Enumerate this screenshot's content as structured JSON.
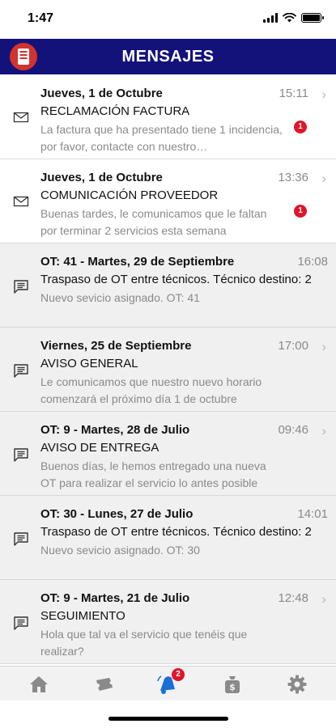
{
  "status_bar": {
    "time": "1:47"
  },
  "header": {
    "title": "MENSAJES",
    "logo_icon": "app-logo-icon"
  },
  "messages": [
    {
      "type": "email",
      "date": "Jueves, 1 de Octubre",
      "time": "15:11",
      "subject": "RECLAMACIÓN FACTURA",
      "preview": "La factura que ha presentado tiene 1 incidencia, por favor, contacte con nuestro…",
      "badge": "1",
      "read": false,
      "chevron": true
    },
    {
      "type": "email",
      "date": "Jueves, 1 de Octubre",
      "time": "13:36",
      "subject": "COMUNICACIÓN PROVEEDOR",
      "preview": "Buenas tardes, le comunicamos que le faltan por terminar 2 servicios esta semana",
      "badge": "1",
      "read": false,
      "chevron": true
    },
    {
      "type": "chat",
      "date": "OT: 41 - Martes, 29 de Septiembre",
      "time": "16:08",
      "subject": "Traspaso de OT entre técnicos. Técnico destino: 2",
      "preview": "Nuevo sevicio asignado. OT: 41",
      "badge": "",
      "read": true,
      "chevron": false
    },
    {
      "type": "chat",
      "date": "Viernes, 25 de Septiembre",
      "time": "17:00",
      "subject": "AVISO GENERAL",
      "preview": "Le comunicamos que nuestro nuevo horario comenzará el próximo día 1 de octubre",
      "badge": "",
      "read": true,
      "chevron": true
    },
    {
      "type": "chat",
      "date": "OT: 9 - Martes, 28 de Julio",
      "time": "09:46",
      "subject": "AVISO DE ENTREGA",
      "preview": "Buenos días, le hemos entregado una nueva OT para realizar el servicio lo antes posible",
      "badge": "",
      "read": true,
      "chevron": true
    },
    {
      "type": "chat",
      "date": "OT: 30 - Lunes, 27 de Julio",
      "time": "14:01",
      "subject": "Traspaso de OT entre técnicos. Técnico destino: 2",
      "preview": "Nuevo sevicio asignado. OT: 30",
      "badge": "",
      "read": true,
      "chevron": false
    },
    {
      "type": "chat",
      "date": "OT: 9 - Martes, 21 de Julio",
      "time": "12:48",
      "subject": "SEGUIMIENTO",
      "preview": "Hola que tal va el servicio que tenéis que realizar?",
      "badge": "",
      "read": true,
      "chevron": true
    }
  ],
  "tabbar": {
    "tabs": [
      {
        "icon": "home-icon",
        "active": false
      },
      {
        "icon": "ticket-icon",
        "active": false
      },
      {
        "icon": "notifications-icon",
        "active": true,
        "badge": "2"
      },
      {
        "icon": "money-bag-icon",
        "active": false
      },
      {
        "icon": "gear-icon",
        "active": false
      }
    ]
  },
  "colors": {
    "header_bg": "#13127a",
    "accent": "#1a6fd6",
    "badge": "#e0152a",
    "logo": "#d0342c"
  }
}
